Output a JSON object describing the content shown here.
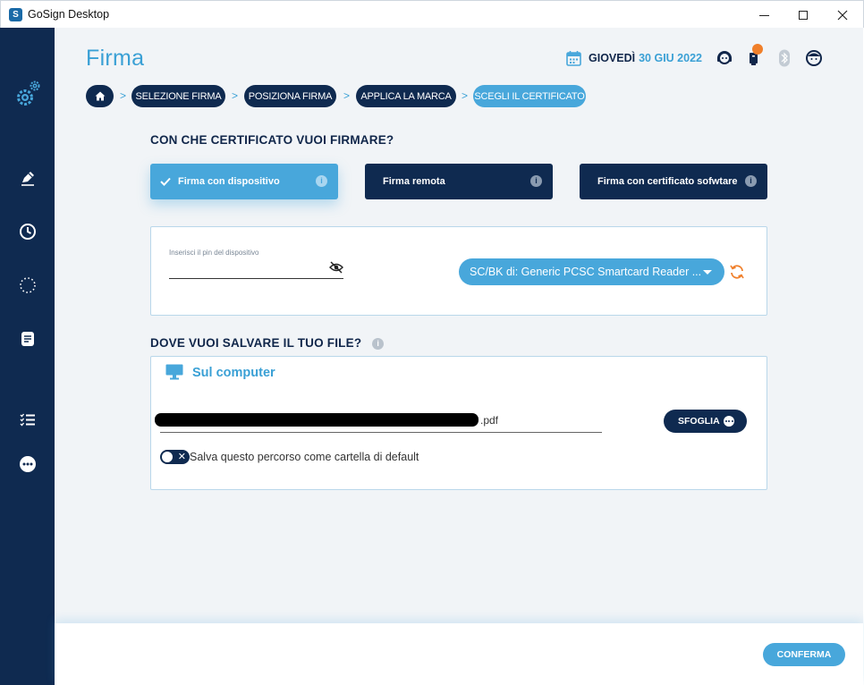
{
  "window": {
    "title": "GoSign Desktop",
    "app_icon_glyph": "S"
  },
  "colors": {
    "navy": "#0f2a50",
    "accent_blue": "#48a7db",
    "title_blue": "#3aa0d5",
    "notification_orange": "#f07f2a",
    "background": "#f1f4f7"
  },
  "sidebar": {
    "items": [
      {
        "icon": "settings-gear-icon"
      },
      {
        "icon": "sign-pen-icon"
      },
      {
        "icon": "history-clock-icon"
      },
      {
        "icon": "loading-dots-circle-icon"
      },
      {
        "icon": "document-icon"
      },
      {
        "icon": "checklist-icon"
      },
      {
        "icon": "more-dots-icon"
      }
    ]
  },
  "header": {
    "page_title": "Firma",
    "day": "GIOVEDÌ",
    "date": "30 GIU 2022",
    "icons": [
      "calendar-icon",
      "support-headset-icon",
      "notification-icon",
      "bluetooth-icon",
      "user-avatar-icon"
    ]
  },
  "breadcrumb": {
    "home_icon": "home-icon",
    "steps": [
      "SELEZIONE FIRMA",
      "POSIZIONA FIRMA",
      "APPLICA LA MARCA",
      "SCEGLI IL CERTIFICATO"
    ],
    "active_step": "SCEGLI IL CERTIFICATO",
    "separator": ">"
  },
  "certificate": {
    "question": "CON CHE CERTIFICATO VUOI FIRMARE?",
    "options": [
      {
        "label": "Firma con dispositivo",
        "selected": true
      },
      {
        "label": "Firma remota",
        "selected": false
      },
      {
        "label": "Firma con certificato sofwtare",
        "selected": false
      }
    ],
    "info_glyph": "i",
    "pin_label": "Inserisci il pin del dispositivo",
    "reader_value": "SC/BK di: Generic PCSC Smartcard Reader ..."
  },
  "save": {
    "question": "DOVE VUOI SALVARE IL TUO FILE?",
    "location": "Sul computer",
    "file_extension": ".pdf",
    "browse_label": "SFOGLIA",
    "toggle_label": "Salva questo percorso come cartella di default",
    "toggle_on": false
  },
  "footer": {
    "confirm_label": "CONFERMA"
  }
}
